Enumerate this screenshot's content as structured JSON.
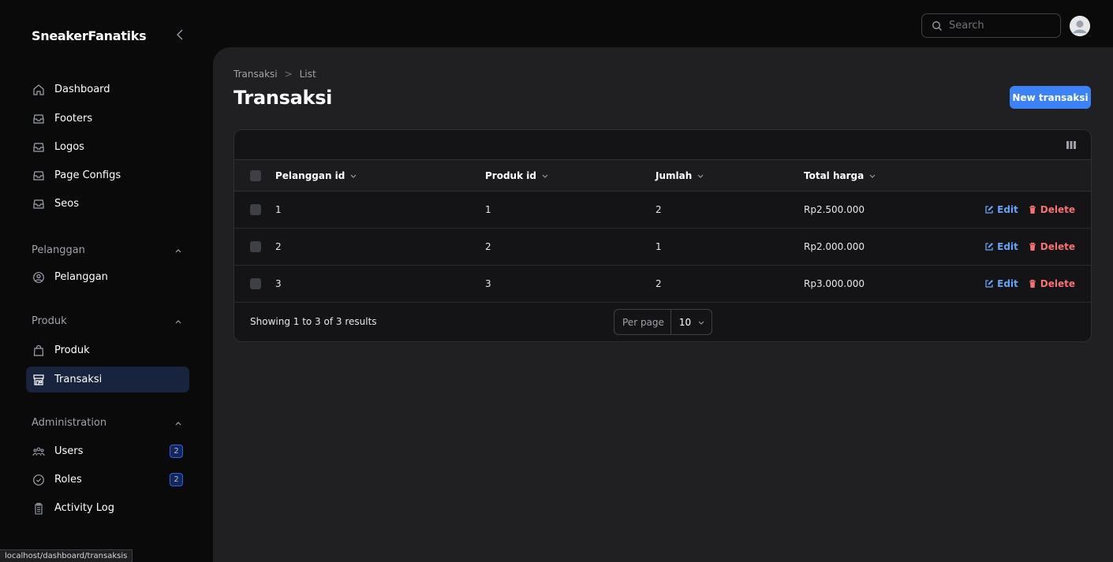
{
  "brand": "SneakerFanatiks",
  "nav": {
    "top_items": [
      {
        "label": "Dashboard",
        "icon": "home-icon"
      },
      {
        "label": "Footers",
        "icon": "inbox-icon"
      },
      {
        "label": "Logos",
        "icon": "inbox-icon"
      },
      {
        "label": "Page Configs",
        "icon": "inbox-icon"
      },
      {
        "label": "Seos",
        "icon": "inbox-icon"
      }
    ],
    "groups": [
      {
        "label": "Pelanggan",
        "items": [
          {
            "label": "Pelanggan",
            "icon": "user-circle-icon"
          }
        ]
      },
      {
        "label": "Produk",
        "items": [
          {
            "label": "Produk",
            "icon": "shopping-bag-icon"
          },
          {
            "label": "Transaksi",
            "icon": "storefront-icon",
            "active": true
          }
        ]
      },
      {
        "label": "Administration",
        "items": [
          {
            "label": "Users",
            "icon": "users-icon",
            "badge": "2"
          },
          {
            "label": "Roles",
            "icon": "shield-check-icon",
            "badge": "2"
          },
          {
            "label": "Activity Log",
            "icon": "clipboard-icon"
          }
        ]
      }
    ]
  },
  "search": {
    "placeholder": "Search"
  },
  "breadcrumb": {
    "parent": "Transaksi",
    "separator": ">",
    "current": "List"
  },
  "page_title": "Transaksi",
  "new_button": "New transaksi",
  "table": {
    "columns": [
      "Pelanggan id",
      "Produk id",
      "Jumlah",
      "Total harga"
    ],
    "rows": [
      {
        "pelanggan_id": "1",
        "produk_id": "1",
        "jumlah": "2",
        "total_harga": "Rp2.500.000"
      },
      {
        "pelanggan_id": "2",
        "produk_id": "2",
        "jumlah": "1",
        "total_harga": "Rp2.000.000"
      },
      {
        "pelanggan_id": "3",
        "produk_id": "3",
        "jumlah": "2",
        "total_harga": "Rp3.000.000"
      }
    ],
    "edit_label": "Edit",
    "delete_label": "Delete",
    "showing_text": "Showing 1 to 3 of 3 results",
    "per_page_label": "Per page",
    "per_page_value": "10"
  },
  "status_url": "localhost/dashboard/transaksis",
  "colors": {
    "accent": "#3b82f6",
    "danger": "#f87171",
    "edit": "#60a5fa",
    "active_nav": "#18233d"
  }
}
